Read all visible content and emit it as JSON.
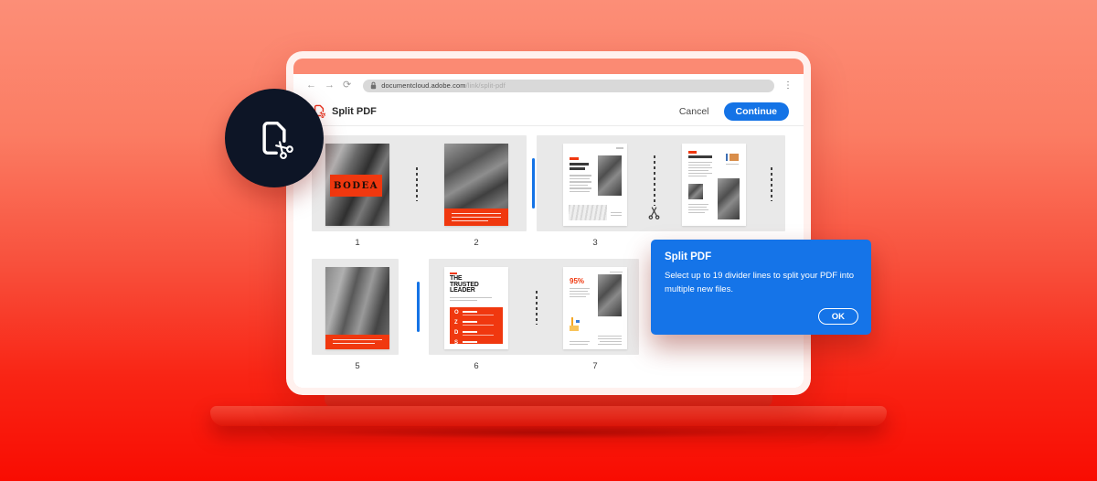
{
  "background": {
    "top_color": "#FC8E77",
    "bottom_color": "#F90C02"
  },
  "badge": {
    "icon": "split-pdf-scissors"
  },
  "browser": {
    "url_domain": "documentcloud.adobe.com",
    "url_path": "/link/split-pdf"
  },
  "appbar": {
    "title": "Split PDF",
    "cancel_label": "Cancel",
    "continue_label": "Continue"
  },
  "popup": {
    "title": "Split PDF",
    "body": "Select up to 19 divider lines to split your PDF into multiple new files.",
    "ok_label": "OK"
  },
  "pages": [
    {
      "num": "1",
      "label": "BODEA"
    },
    {
      "num": "2"
    },
    {
      "num": "3"
    },
    {
      "num": ""
    },
    {
      "num": "5"
    },
    {
      "num": "6",
      "title_lines": [
        "THE",
        "TRUSTED",
        "LEADER"
      ],
      "list_glyphs": [
        "O",
        "Z",
        "D",
        "S"
      ]
    },
    {
      "num": "7",
      "stat": "95%"
    }
  ],
  "dividers": [
    {
      "after_page": 1,
      "state": "unselected-dashed"
    },
    {
      "after_page": 2,
      "state": "selected-blue"
    },
    {
      "after_page": 3,
      "state": "hover-scissors"
    },
    {
      "after_page": 4,
      "state": "unselected-dashed"
    },
    {
      "after_page": 5,
      "state": "selected-blue"
    },
    {
      "after_page": 6,
      "state": "unselected-dashed"
    }
  ],
  "colors": {
    "accent_blue": "#1473E6",
    "doc_red": "#F0380F",
    "popup_blue": "#1574E8",
    "badge_navy": "#0D1526"
  }
}
